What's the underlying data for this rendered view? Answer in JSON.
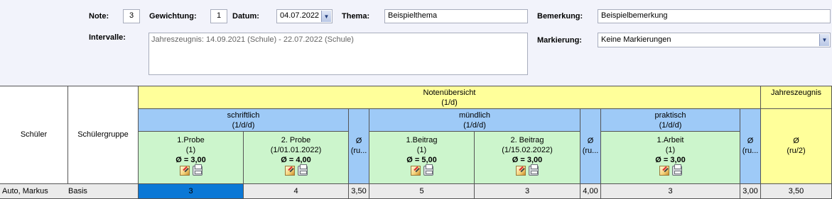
{
  "form": {
    "note_label": "Note:",
    "note_value": "3",
    "gewichtung_label": "Gewichtung:",
    "gewichtung_value": "1",
    "datum_label": "Datum:",
    "datum_value": "04.07.2022",
    "thema_label": "Thema:",
    "thema_value": "Beispielthema",
    "bemerkung_label": "Bemerkung:",
    "bemerkung_value": "Beispielbemerkung",
    "intervalle_label": "Intervalle:",
    "intervalle_value": "Jahreszeugnis: 14.09.2021 (Schule) - 22.07.2022 (Schule)",
    "markierung_label": "Markierung:",
    "markierung_value": "Keine Markierungen"
  },
  "grid": {
    "schueler_header": "Schüler",
    "gruppe_header": "Schülergruppe",
    "notenuebersicht_title": "Notenübersicht",
    "notenuebersicht_sub": "(1/d)",
    "jahreszeugnis_title": "Jahreszeugnis",
    "schriftlich_title": "schriftlich",
    "schriftlich_sub": "(1/d/d)",
    "muendlich_title": "mündlich",
    "muendlich_sub": "(1/d/d)",
    "praktisch_title": "praktisch",
    "praktisch_sub": "(1/d/d)",
    "avg_symbol": "Ø",
    "avg_sub_trunc": "(ru...",
    "jz_avg_sub": "(ru/2)",
    "exams": [
      {
        "title": "1.Probe",
        "sub": "(1)",
        "avg": "Ø = 3,00"
      },
      {
        "title": "2. Probe",
        "sub": "(1/01.01.2022)",
        "avg": "Ø = 4,00"
      },
      {
        "title": "1.Beitrag",
        "sub": "(1)",
        "avg": "Ø = 5,00"
      },
      {
        "title": "2. Beitrag",
        "sub": "(1/15.02.2022)",
        "avg": "Ø = 3,00"
      },
      {
        "title": "1.Arbeit",
        "sub": "(1)",
        "avg": "Ø = 3,00"
      }
    ],
    "row": {
      "student": "Auto, Markus",
      "group": "Basis",
      "grades": [
        "3",
        "4",
        "3,50",
        "5",
        "3",
        "4,00",
        "3",
        "3,00",
        "3,50"
      ]
    }
  },
  "colors": {
    "yellow": "#ffff9a",
    "blue": "#9ecaf7",
    "green": "#ccf5cc",
    "selected": "#0b78d6"
  },
  "icons": [
    "edit-icon",
    "print-icon"
  ]
}
